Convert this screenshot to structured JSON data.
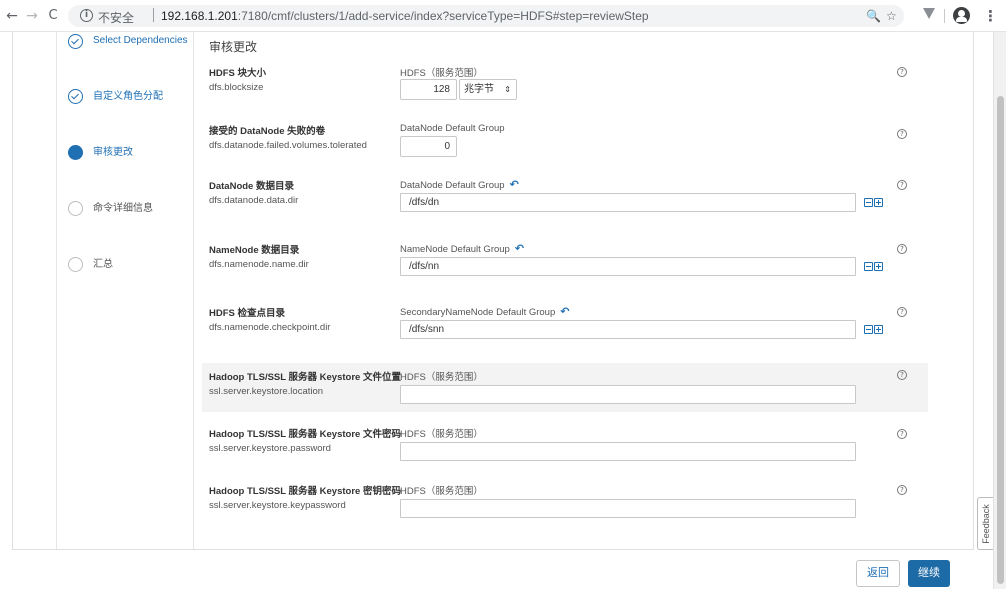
{
  "browser": {
    "back_icon": "←",
    "forward_icon": "→",
    "reload_icon": "C",
    "info_icon": "i",
    "insecure_label": "不安全",
    "url_host": "192.168.1.201",
    "url_rest": ":7180/cmf/clusters/1/add-service/index?serviceType=HDFS#step=reviewStep",
    "zoom_icon": "🔍",
    "star_icon": "☆",
    "menu_icon": "⋮"
  },
  "steps": [
    {
      "label": "Select Dependencies",
      "state": "done"
    },
    {
      "label": "自定义角色分配",
      "state": "done"
    },
    {
      "label": "审核更改",
      "state": "current"
    },
    {
      "label": "命令详细信息",
      "state": "pending"
    },
    {
      "label": "汇总",
      "state": "pending"
    }
  ],
  "page_title": "审核更改",
  "properties": [
    {
      "name": "HDFS 块大小",
      "key": "dfs.blocksize",
      "scope": "HDFS（服务范围）",
      "value": "128",
      "unit": "兆字节"
    },
    {
      "name": "接受的 DataNode 失败的卷",
      "key": "dfs.datanode.failed.volumes.tolerated",
      "scope": "DataNode Default Group",
      "value": "0"
    },
    {
      "name": "DataNode 数据目录",
      "key": "dfs.datanode.data.dir",
      "scope": "DataNode Default Group",
      "value": "/dfs/dn"
    },
    {
      "name": "NameNode 数据目录",
      "key": "dfs.namenode.name.dir",
      "scope": "NameNode Default Group",
      "value": "/dfs/nn"
    },
    {
      "name": "HDFS 检查点目录",
      "key": "dfs.namenode.checkpoint.dir",
      "scope": "SecondaryNameNode Default Group",
      "value": "/dfs/snn"
    },
    {
      "name": "Hadoop TLS/SSL 服务器 Keystore 文件位置",
      "key": "ssl.server.keystore.location",
      "scope": "HDFS（服务范围）",
      "value": ""
    },
    {
      "name": "Hadoop TLS/SSL 服务器 Keystore 文件密码",
      "key": "ssl.server.keystore.password",
      "scope": "HDFS（服务范围）",
      "value": ""
    },
    {
      "name": "Hadoop TLS/SSL 服务器 Keystore 密钥密码",
      "key": "ssl.server.keystore.keypassword",
      "scope": "HDFS（服务范围）",
      "value": ""
    }
  ],
  "help_icon": "?",
  "undo_icon": "↶",
  "select_arrows": "⇕",
  "feedback_label": "Feedback",
  "buttons": {
    "back": "返回",
    "continue": "继续"
  },
  "colors": {
    "accent": "#1f6fb3",
    "primary_button": "#1c6aa6"
  }
}
